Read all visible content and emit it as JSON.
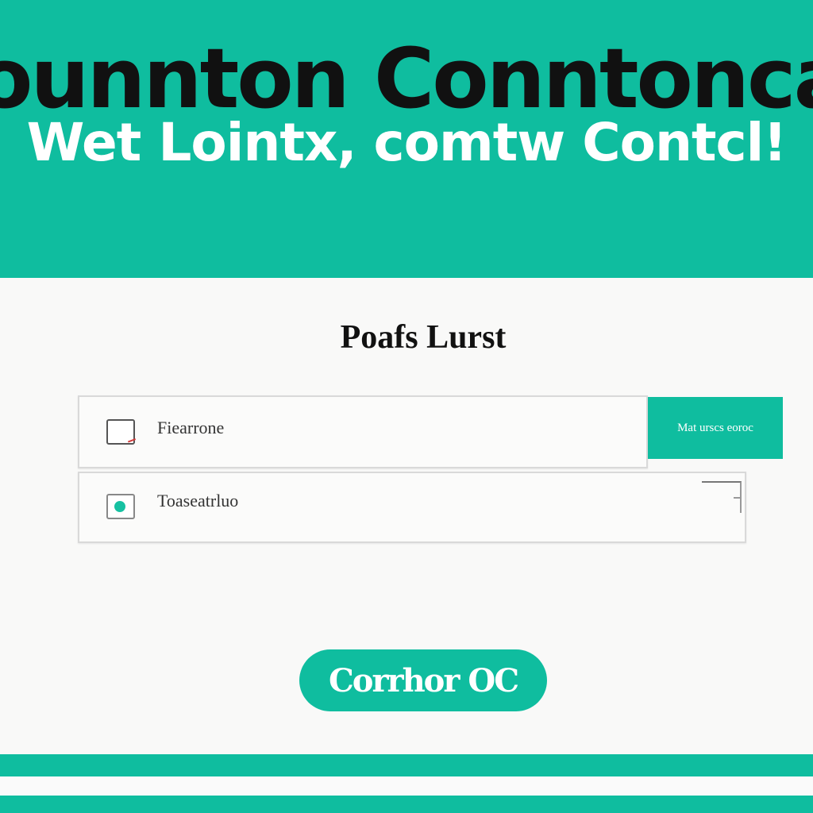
{
  "hero": {
    "title": "ounnton Conntonca",
    "subtitle": "Wet Lointx, comtw Contcl!"
  },
  "main": {
    "heading": "Poafs Lurst",
    "options": [
      {
        "label": "Fiearrone",
        "state": "checked"
      },
      {
        "label": "Toaseatrluo",
        "state": "selected"
      }
    ],
    "side_button_label": "Mat urscs eoroc",
    "cta_label": "Corrhor OC"
  },
  "colors": {
    "accent": "#0fbd9f",
    "title_text": "#111111",
    "subtitle_text": "#ffffff",
    "background": "#f9f9f8"
  }
}
